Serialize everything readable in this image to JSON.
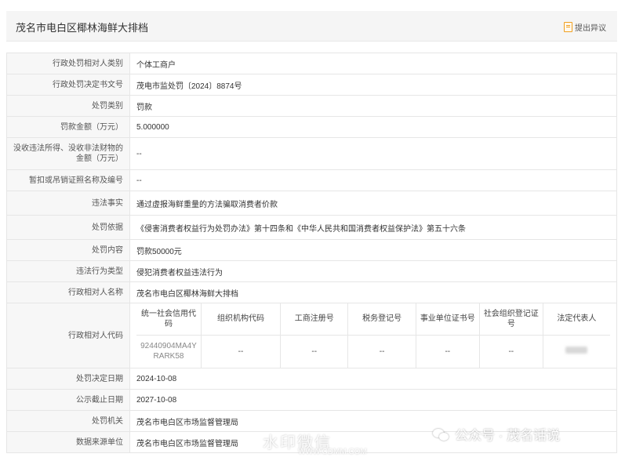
{
  "header": {
    "title": "茂名市电白区椰林海鲜大排档",
    "objection_label": "提出异议"
  },
  "rows_top": [
    {
      "label": "行政处罚相对人类别",
      "value": "个体工商户"
    },
    {
      "label": "行政处罚决定书文号",
      "value": "茂电市监处罚〔2024〕8874号"
    },
    {
      "label": "处罚类别",
      "value": "罚款"
    },
    {
      "label": "罚款金额（万元）",
      "value": "5.000000"
    },
    {
      "label": "没收违法所得、没收非法财物的金额（万元）",
      "value": "--"
    },
    {
      "label": "暂扣或吊销证照名称及编号",
      "value": "--"
    },
    {
      "label": "违法事实",
      "value": "通过虚报海鲜重量的方法骗取消费者价款"
    },
    {
      "label": "处罚依据",
      "value": "《侵害消费者权益行为处罚办法》第十四条和《中华人民共和国消费者权益保护法》第五十六条"
    },
    {
      "label": "处罚内容",
      "value": "罚款50000元"
    },
    {
      "label": "违法行为类型",
      "value": "侵犯消费者权益违法行为"
    },
    {
      "label": "行政相对人名称",
      "value": "茂名市电白区椰林海鲜大排档"
    }
  ],
  "codes": {
    "label": "行政相对人代码",
    "headers": [
      "统一社会信用代码",
      "组织机构代码",
      "工商注册号",
      "税务登记号",
      "事业单位证书号",
      "社会组织登记证号",
      "法定代表人"
    ],
    "values": [
      "92440904MA4YRARK58",
      "--",
      "--",
      "--",
      "--",
      "--",
      ""
    ]
  },
  "rows_bottom": [
    {
      "label": "处罚决定日期",
      "value": "2024-10-08"
    },
    {
      "label": "公示截止日期",
      "value": "2027-10-08"
    },
    {
      "label": "处罚机关",
      "value": "茂名市电白区市场监督管理局"
    },
    {
      "label": "数据来源单位",
      "value": "茂名市电白区市场监督管理局"
    }
  ],
  "watermark": {
    "right_text": "公众号 · 茂名话说",
    "center_text": "水印微信",
    "center_url": "WWW.CDMM.COM"
  }
}
